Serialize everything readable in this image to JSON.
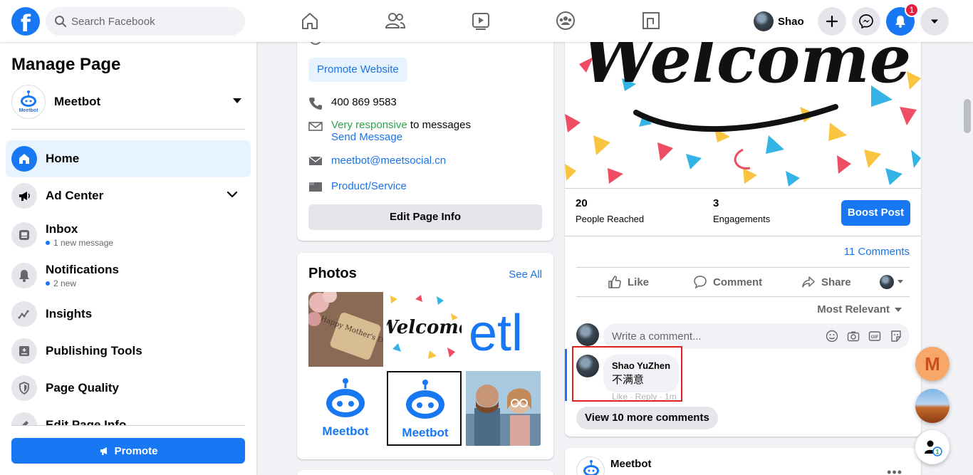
{
  "header": {
    "logo": "f",
    "search_placeholder": "Search Facebook",
    "nav_icons": [
      "home-icon",
      "people-icon",
      "watch-icon",
      "groups-icon",
      "gaming-icon"
    ],
    "profile_name": "Shao",
    "notification_count": "1"
  },
  "sidebar": {
    "title": "Manage Page",
    "page_name": "Meetbot",
    "items": [
      {
        "label": "Home",
        "sub": "",
        "icon": "home-icon"
      },
      {
        "label": "Ad Center",
        "sub": "",
        "icon": "megaphone-icon"
      },
      {
        "label": "Inbox",
        "sub": "1 new message",
        "icon": "inbox-icon"
      },
      {
        "label": "Notifications",
        "sub": "2 new",
        "icon": "bell-icon"
      },
      {
        "label": "Insights",
        "sub": "",
        "icon": "insights-icon"
      },
      {
        "label": "Publishing Tools",
        "sub": "",
        "icon": "publishing-icon"
      },
      {
        "label": "Page Quality",
        "sub": "",
        "icon": "shield-icon"
      },
      {
        "label": "Edit Page Info",
        "sub": "",
        "icon": "pencil-icon"
      }
    ],
    "promote_label": "Promote"
  },
  "about": {
    "promote_website": "Promote Website",
    "phone": "400 869 9583",
    "responsive": "Very responsive",
    "responsive_suffix": " to messages",
    "send_message": "Send Message",
    "email": "meetbot@meetsocial.cn",
    "category": "Product/Service",
    "edit_info": "Edit Page Info"
  },
  "photos": {
    "title": "Photos",
    "see_all": "See All",
    "items": [
      "Happy Mother's Day!",
      "Welcome",
      "etl",
      "Meetbot",
      "Meetbot",
      "couple"
    ]
  },
  "post": {
    "people_reached": "20",
    "people_reached_label": "People Reached",
    "engagements": "3",
    "engagements_label": "Engagements",
    "boost_label": "Boost Post",
    "comments_count": "11 Comments",
    "actions": {
      "like": "Like",
      "comment": "Comment",
      "share": "Share"
    },
    "sort_label": "Most Relevant",
    "write_placeholder": "Write a comment...",
    "comment": {
      "author": "Shao YuZhen",
      "text": "不满意",
      "meta": "Like · Reply · 1m"
    },
    "view_more": "View 10 more comments"
  },
  "post2": {
    "author": "Meetbot",
    "more": "•••"
  },
  "chatheads": {
    "m_letter": "M",
    "new_count": "1"
  },
  "colors": {
    "brand": "#1877f2",
    "badge": "#e41e3f",
    "highlight": "#e0201d",
    "green": "#31a24c"
  }
}
